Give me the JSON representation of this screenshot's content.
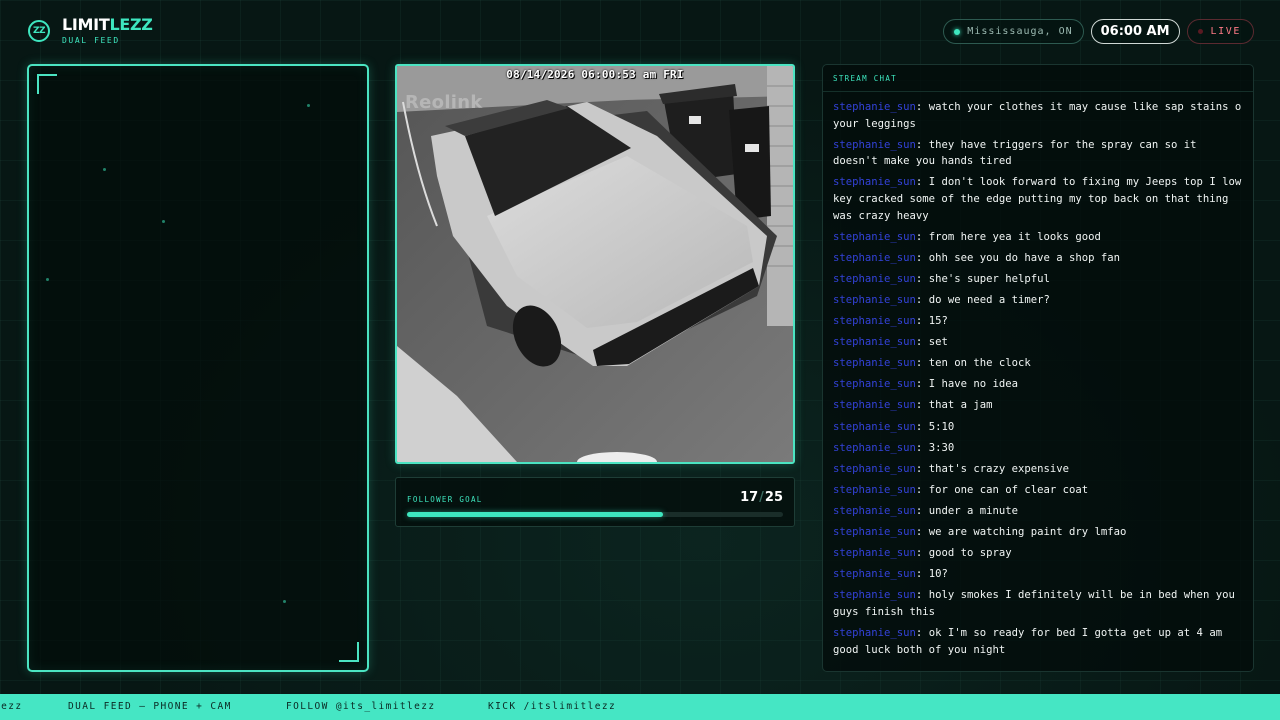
{
  "header": {
    "brand_name_a": "LIMIT",
    "brand_name_b": "LEZZ",
    "brand_sub": "DUAL FEED",
    "logo_text": "ZZ",
    "location": "Mississauga, ON",
    "time": "06:00 AM",
    "live_label": "LIVE"
  },
  "camera": {
    "timestamp": "08/14/2026 06:00:53 am FRI",
    "watermark": "Reolink"
  },
  "goal": {
    "label": "FOLLOWER GOAL",
    "current": "17",
    "target": "25",
    "progress": 0.68
  },
  "chat": {
    "title": "STREAM CHAT",
    "messages": [
      {
        "user": "stephanie_sun",
        "text": "watch your clothes it may cause like sap stains o your leggings"
      },
      {
        "user": "stephanie_sun",
        "text": "they have triggers for the spray can so it doesn't make you hands tired"
      },
      {
        "user": "stephanie_sun",
        "text": "I don't look forward to fixing my Jeeps top I low key cracked some of the edge putting my top back on that thing was crazy heavy"
      },
      {
        "user": "stephanie_sun",
        "text": "from here yea it looks good"
      },
      {
        "user": "stephanie_sun",
        "text": "ohh see you do have a shop fan"
      },
      {
        "user": "stephanie_sun",
        "text": "she's super helpful"
      },
      {
        "user": "stephanie_sun",
        "text": "do we need a timer?"
      },
      {
        "user": "stephanie_sun",
        "text": "15?"
      },
      {
        "user": "stephanie_sun",
        "text": "set"
      },
      {
        "user": "stephanie_sun",
        "text": "ten on the clock"
      },
      {
        "user": "stephanie_sun",
        "text": "I have no idea"
      },
      {
        "user": "stephanie_sun",
        "text": "that a jam"
      },
      {
        "user": "stephanie_sun",
        "text": "5:10"
      },
      {
        "user": "stephanie_sun",
        "text": "3:30"
      },
      {
        "user": "stephanie_sun",
        "text": "that's crazy expensive"
      },
      {
        "user": "stephanie_sun",
        "text": "for one can of clear coat"
      },
      {
        "user": "stephanie_sun",
        "text": "under a minute"
      },
      {
        "user": "stephanie_sun",
        "text": "we are watching paint dry lmfao"
      },
      {
        "user": "stephanie_sun",
        "text": "good to spray"
      },
      {
        "user": "stephanie_sun",
        "text": "10?"
      },
      {
        "user": "stephanie_sun",
        "text": "holy smokes I definitely will be in bed when you guys finish this"
      },
      {
        "user": "stephanie_sun",
        "text": "ok I'm so ready for bed I gotta get up at 4 am good luck both of you night"
      }
    ]
  },
  "ticker": {
    "items": [
      "lezz",
      "DUAL FEED — PHONE + CAM",
      "FOLLOW @its_limitlezz",
      "KICK /itslimitlezz"
    ]
  },
  "colors": {
    "accent": "#3ee6bf",
    "username": "#3342d8",
    "live": "#ff7a86",
    "ticker_bg": "#45e6c4"
  }
}
